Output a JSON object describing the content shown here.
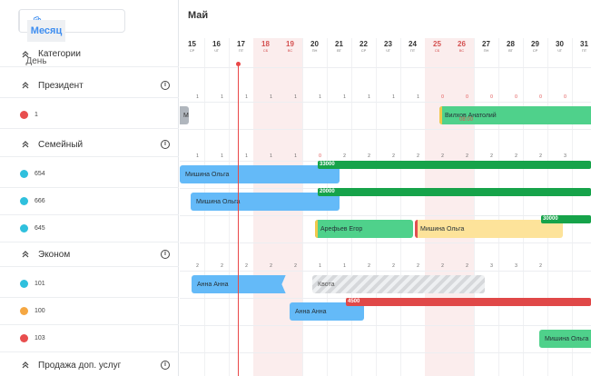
{
  "toolbar": {
    "day_label": "День",
    "month_label": "Месяц",
    "settings_icon": "gear-icon"
  },
  "calendar": {
    "month_title": "Май",
    "days": [
      {
        "num": "15",
        "wd": "СР",
        "weekend": false
      },
      {
        "num": "16",
        "wd": "ЧТ",
        "weekend": false
      },
      {
        "num": "17",
        "wd": "ПТ",
        "weekend": false
      },
      {
        "num": "18",
        "wd": "СБ",
        "weekend": true
      },
      {
        "num": "19",
        "wd": "ВС",
        "weekend": true
      },
      {
        "num": "20",
        "wd": "ПН",
        "weekend": false
      },
      {
        "num": "21",
        "wd": "ВТ",
        "weekend": false
      },
      {
        "num": "22",
        "wd": "СР",
        "weekend": false
      },
      {
        "num": "23",
        "wd": "ЧТ",
        "weekend": false
      },
      {
        "num": "24",
        "wd": "ПТ",
        "weekend": false
      },
      {
        "num": "25",
        "wd": "СБ",
        "weekend": true
      },
      {
        "num": "26",
        "wd": "ВС",
        "weekend": true
      },
      {
        "num": "27",
        "wd": "ПН",
        "weekend": false
      },
      {
        "num": "28",
        "wd": "ВТ",
        "weekend": false
      },
      {
        "num": "29",
        "wd": "СР",
        "weekend": false
      },
      {
        "num": "30",
        "wd": "ЧТ",
        "weekend": false
      },
      {
        "num": "31",
        "wd": "ПТ",
        "weekend": false
      }
    ]
  },
  "header": {
    "categories_label": "Категории"
  },
  "categories": [
    {
      "title": "Президент",
      "counts": [
        "1",
        "1",
        "1",
        "1",
        "1",
        "1",
        "1",
        "1",
        "1",
        "1",
        "0",
        "0",
        "0",
        "0",
        "0",
        "0",
        ""
      ],
      "rooms": [
        {
          "name": "1",
          "color": "#e84e4e"
        }
      ]
    },
    {
      "title": "Семейный",
      "counts": [
        "1",
        "1",
        "1",
        "1",
        "1",
        "0",
        "2",
        "2",
        "2",
        "2",
        "2",
        "2",
        "2",
        "2",
        "2",
        "3",
        ""
      ],
      "rooms": [
        {
          "name": "654",
          "color": "#2fc0dd"
        },
        {
          "name": "666",
          "color": "#2fc0dd"
        },
        {
          "name": "645",
          "color": "#2fc0dd"
        }
      ]
    },
    {
      "title": "Эконом",
      "counts": [
        "2",
        "2",
        "2",
        "2",
        "2",
        "1",
        "1",
        "2",
        "2",
        "2",
        "2",
        "2",
        "3",
        "3",
        "2",
        "",
        ""
      ],
      "rooms": [
        {
          "name": "101",
          "color": "#2fc0dd"
        },
        {
          "name": "100",
          "color": "#f5a742"
        },
        {
          "name": "103",
          "color": "#e84e4e"
        }
      ]
    },
    {
      "title": "Продажа доп. услуг",
      "counts": [],
      "rooms": []
    }
  ],
  "bookings": [
    {
      "guest": "М",
      "row": "1",
      "color": "grey"
    },
    {
      "guest": "Вилхов Анатолий",
      "time": "08:00",
      "row": "1",
      "color": "green"
    },
    {
      "guest": "Мишина Ольга",
      "price": "33000",
      "row": "654",
      "color": "blue"
    },
    {
      "guest": "Мишина Ольга",
      "price": "20000",
      "row": "666",
      "color": "blue"
    },
    {
      "guest": "Арефьев Егор",
      "row": "645",
      "color": "green"
    },
    {
      "guest": "Мишина Ольга",
      "price": "30000",
      "row": "645",
      "color": "yellow"
    },
    {
      "guest": "Анна Анна",
      "row": "101",
      "color": "blue"
    },
    {
      "guest": "Квота",
      "row": "101",
      "color": "hatch"
    },
    {
      "guest": "Анна Анна",
      "price": "4500",
      "row": "100",
      "color": "blue"
    },
    {
      "guest": "Мишина Ольга",
      "row": "103",
      "color": "green"
    }
  ],
  "colors": {
    "accent": "#3f8ef0",
    "today_line": "#e94848",
    "weekend_bg": "#fbeded",
    "price_green": "#16a34a",
    "price_red": "#e04848"
  }
}
